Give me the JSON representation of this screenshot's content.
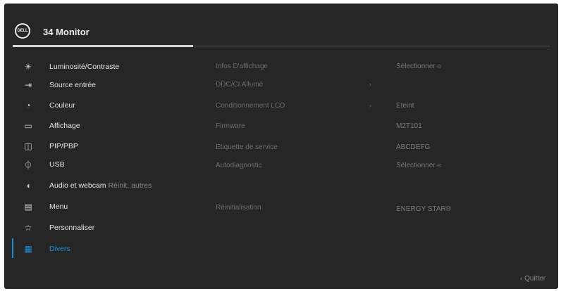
{
  "header": {
    "logo_text": "DELL",
    "title": "34 Monitor"
  },
  "menu": {
    "items": [
      {
        "label": "Luminosité/Contraste",
        "icon": "brightness-icon",
        "glyph": "☀"
      },
      {
        "label": "Source entrée",
        "icon": "input-source-icon",
        "glyph": "⇥"
      },
      {
        "label": "Couleur",
        "icon": "color-icon",
        "glyph": "◔"
      },
      {
        "label": "Affichage",
        "icon": "display-icon",
        "glyph": "▭"
      },
      {
        "label": "PIP/PBP",
        "icon": "pip-icon",
        "glyph": "◫"
      },
      {
        "label": "USB",
        "icon": "usb-icon",
        "glyph": "⏀"
      },
      {
        "label": "Audio et webcam",
        "sub": "Réinit. autres",
        "icon": "audio-icon",
        "glyph": "◖"
      },
      {
        "label": "Menu",
        "icon": "menu-icon",
        "glyph": "▤"
      },
      {
        "label": "Personnaliser",
        "icon": "star-icon",
        "glyph": "☆"
      },
      {
        "label": "Divers",
        "icon": "others-icon",
        "glyph": "▦",
        "active": true
      }
    ]
  },
  "options": [
    {
      "label": "Infos D'affichage",
      "value": "Sélectionner",
      "value_icon": "⊙"
    },
    {
      "label": "DDC/CI Allumé",
      "chevron": "›",
      "value": ""
    },
    {
      "label": "Conditionnement LCD",
      "chevron": "›",
      "value": "Eteint"
    },
    {
      "label": "Firmware",
      "value": "M2T101"
    },
    {
      "label": "Étiquette de service",
      "value": "ABCDEFG"
    },
    {
      "label": "Autodiagnostic",
      "value": "Sélectionner",
      "value_icon": "⊙"
    },
    {
      "label": "Réinitialisation",
      "value": "ENERGY STAR®"
    }
  ],
  "footer": {
    "quit_label": "‹ Quitter"
  },
  "colors": {
    "background": "#262626",
    "accent": "#1a8fd8"
  }
}
